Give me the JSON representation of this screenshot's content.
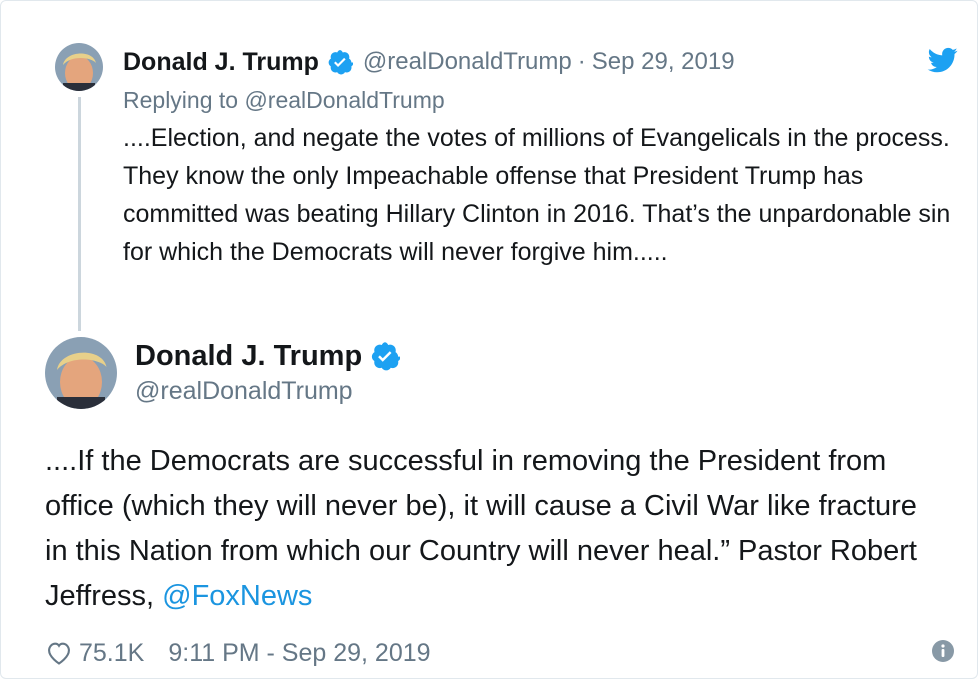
{
  "parent_tweet": {
    "name": "Donald J. Trump",
    "handle": "@realDonaldTrump",
    "separator": "·",
    "date": "Sep 29, 2019",
    "replying_to": "Replying to @realDonaldTrump",
    "text": "....Election, and negate the votes of millions of Evangelicals in the process. They know the only Impeachable offense that President Trump has committed was beating Hillary Clinton in 2016. That’s the unpardonable sin for which the Democrats will never forgive him....."
  },
  "main_tweet": {
    "name": "Donald J. Trump",
    "handle": "@realDonaldTrump",
    "text": "....If the Democrats are successful in removing the President from office (which they will never be), it will cause a Civil War like fracture in this Nation from which our Country will never heal.” Pastor Robert Jeffress, ",
    "link": "@FoxNews",
    "likes": "75.1K",
    "timestamp": "9:11 PM - Sep 29, 2019"
  },
  "icons": {
    "brand": "twitter-bird-icon",
    "verified": "verified-badge-icon",
    "like": "heart-icon",
    "info": "info-icon"
  },
  "colors": {
    "twitter_blue": "#1da1f2",
    "link_blue": "#1b95e0",
    "muted_gray": "#657786",
    "text": "#14171a"
  }
}
